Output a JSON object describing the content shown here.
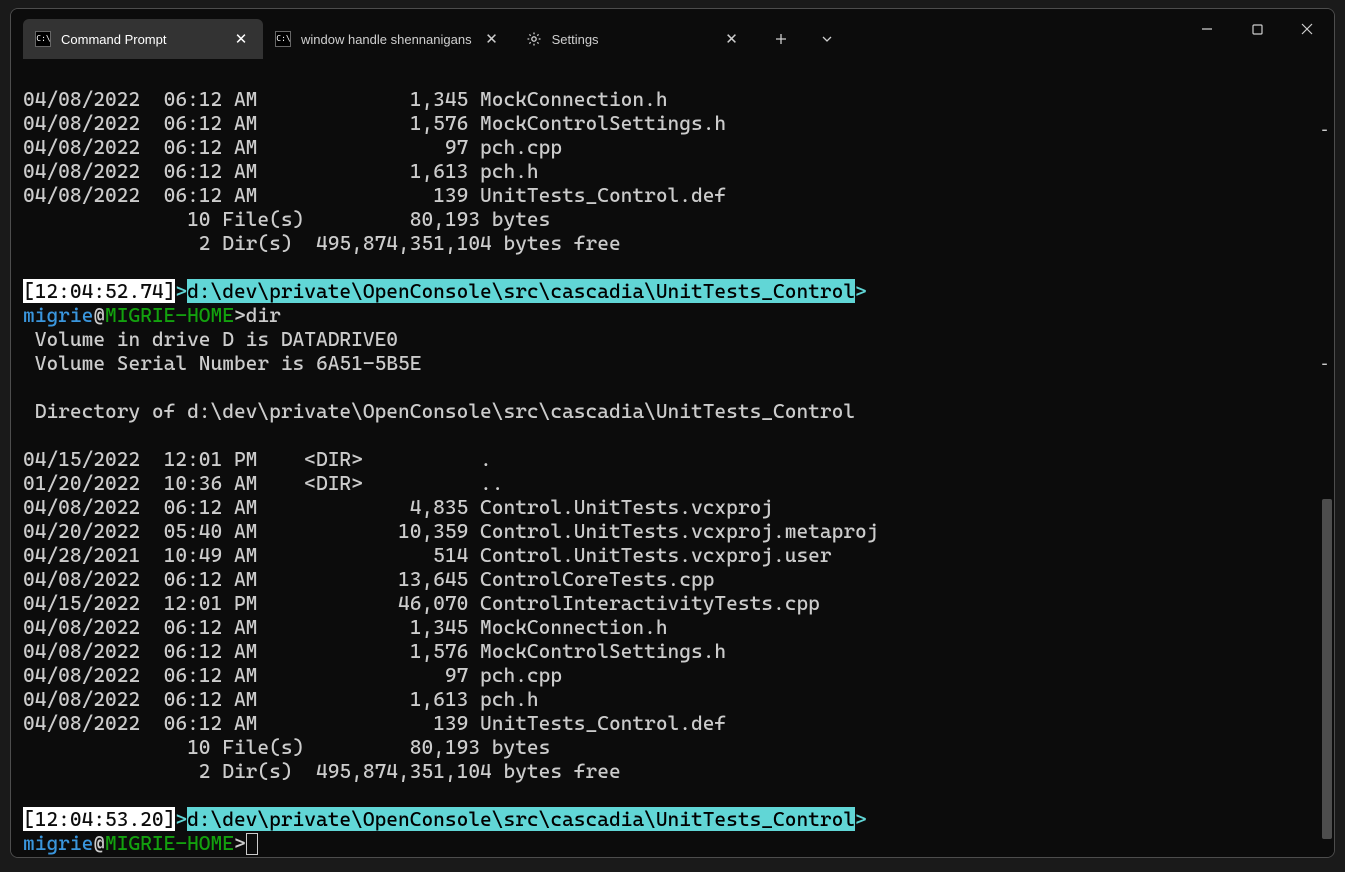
{
  "tabs": [
    {
      "label": "Command Prompt",
      "icon": "cmd",
      "active": true
    },
    {
      "label": "window handle shennanigans",
      "icon": "cmd",
      "active": false
    },
    {
      "label": "Settings",
      "icon": "gear",
      "active": false
    }
  ],
  "terminal_top_listing": [
    "04/08/2022  06:12 AM             1,345 MockConnection.h",
    "04/08/2022  06:12 AM             1,576 MockControlSettings.h",
    "04/08/2022  06:12 AM                97 pch.cpp",
    "04/08/2022  06:12 AM             1,613 pch.h",
    "04/08/2022  06:12 AM               139 UnitTests_Control.def",
    "              10 File(s)         80,193 bytes",
    "               2 Dir(s)  495,874,351,104 bytes free"
  ],
  "prompt1": {
    "time": "[12:04:52.74]",
    "angle_open": ">",
    "path": "d:\\dev\\private\\OpenConsole\\src\\cascadia\\UnitTests_Control",
    "angle_close": ">",
    "user": "migrie",
    "at": "@",
    "host": "MIGRIE-HOME",
    "gt": ">",
    "cmd": "dir"
  },
  "dir_output": [
    " Volume in drive D is DATADRIVE0",
    " Volume Serial Number is 6A51-5B5E",
    "",
    " Directory of d:\\dev\\private\\OpenConsole\\src\\cascadia\\UnitTests_Control",
    "",
    "04/15/2022  12:01 PM    <DIR>          .",
    "01/20/2022  10:36 AM    <DIR>          ..",
    "04/08/2022  06:12 AM             4,835 Control.UnitTests.vcxproj",
    "04/20/2022  05:40 AM            10,359 Control.UnitTests.vcxproj.metaproj",
    "04/28/2021  10:49 AM               514 Control.UnitTests.vcxproj.user",
    "04/08/2022  06:12 AM            13,645 ControlCoreTests.cpp",
    "04/15/2022  12:01 PM            46,070 ControlInteractivityTests.cpp",
    "04/08/2022  06:12 AM             1,345 MockConnection.h",
    "04/08/2022  06:12 AM             1,576 MockControlSettings.h",
    "04/08/2022  06:12 AM                97 pch.cpp",
    "04/08/2022  06:12 AM             1,613 pch.h",
    "04/08/2022  06:12 AM               139 UnitTests_Control.def",
    "              10 File(s)         80,193 bytes",
    "               2 Dir(s)  495,874,351,104 bytes free"
  ],
  "prompt2": {
    "time": "[12:04:53.20]",
    "angle_open": ">",
    "path": "d:\\dev\\private\\OpenConsole\\src\\cascadia\\UnitTests_Control",
    "angle_close": ">",
    "user": "migrie",
    "at": "@",
    "host": "MIGRIE-HOME",
    "gt": ">"
  },
  "marks": [
    62,
    296,
    532,
    546
  ]
}
